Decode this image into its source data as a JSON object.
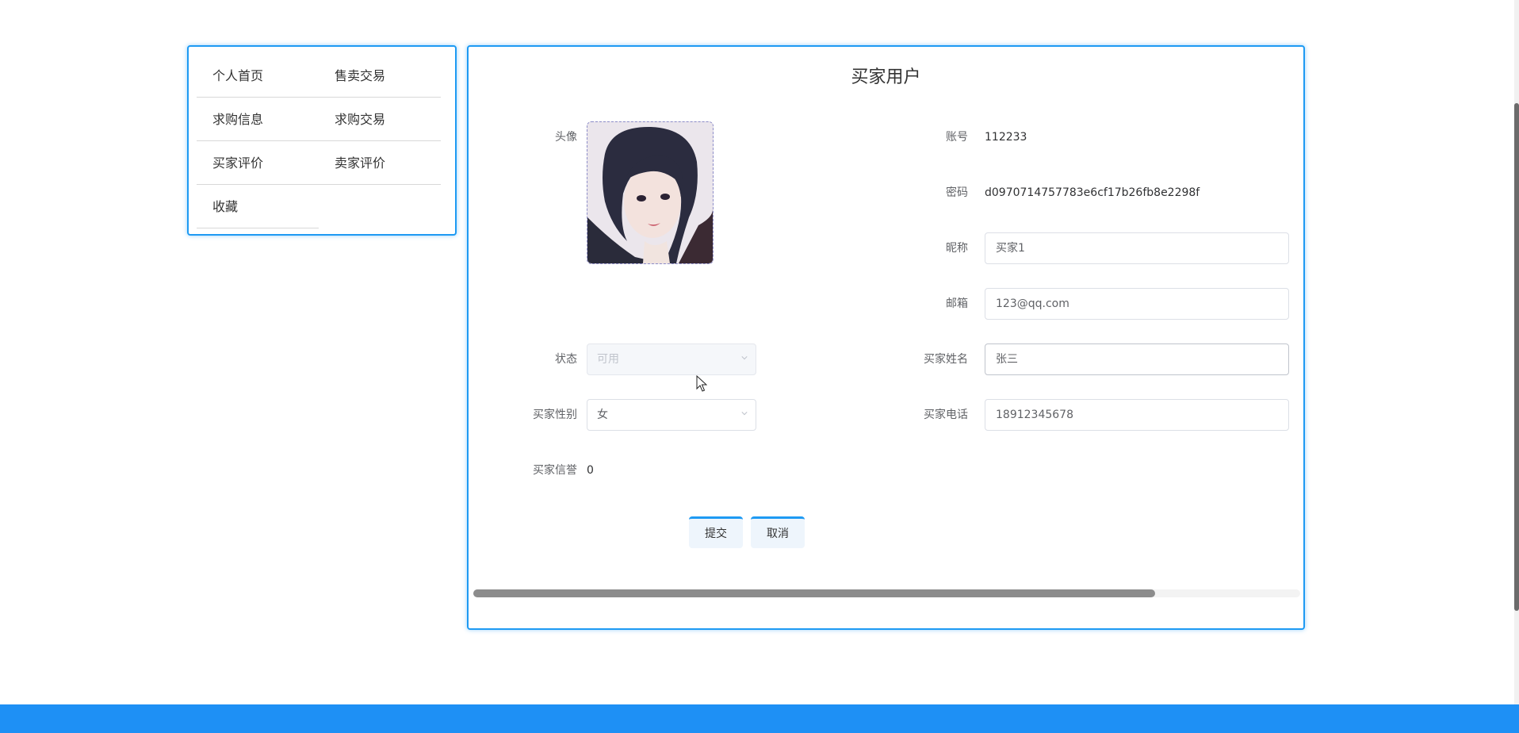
{
  "menu": {
    "items": [
      {
        "label": "个人首页"
      },
      {
        "label": "售卖交易"
      },
      {
        "label": "求购信息"
      },
      {
        "label": "求购交易"
      },
      {
        "label": "买家评价"
      },
      {
        "label": "卖家评价"
      },
      {
        "label": "收藏"
      }
    ]
  },
  "form": {
    "title": "买家用户",
    "avatar_label": "头像",
    "account": {
      "label": "账号",
      "value": "112233"
    },
    "password": {
      "label": "密码",
      "value": "d0970714757783e6cf17b26fb8e2298f"
    },
    "nickname": {
      "label": "昵称",
      "value": "买家1"
    },
    "email": {
      "label": "邮箱",
      "value": "123@qq.com"
    },
    "status": {
      "label": "状态",
      "value": "可用"
    },
    "buyer_name": {
      "label": "买家姓名",
      "value": "张三"
    },
    "buyer_gender": {
      "label": "买家性别",
      "value": "女"
    },
    "buyer_phone": {
      "label": "买家电话",
      "value": "18912345678"
    },
    "buyer_credit": {
      "label": "买家信誉",
      "value": "0"
    },
    "submit_label": "提交",
    "cancel_label": "取消"
  },
  "colors": {
    "accent": "#1e9af3",
    "footer": "#1e90f5"
  },
  "icons": {
    "select_arrow": "chevron-down-icon",
    "cursor": "mouse-pointer-icon"
  }
}
